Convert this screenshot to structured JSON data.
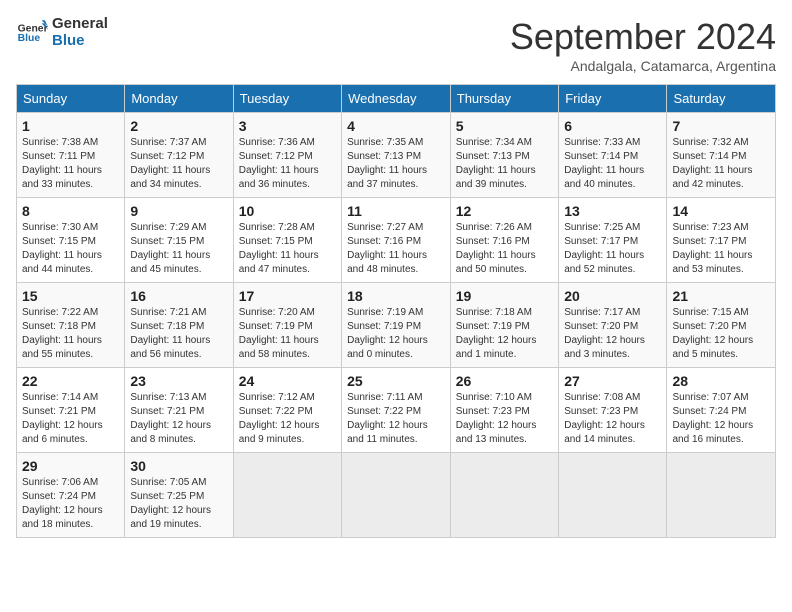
{
  "header": {
    "logo_line1": "General",
    "logo_line2": "Blue",
    "title": "September 2024",
    "subtitle": "Andalgala, Catamarca, Argentina"
  },
  "weekdays": [
    "Sunday",
    "Monday",
    "Tuesday",
    "Wednesday",
    "Thursday",
    "Friday",
    "Saturday"
  ],
  "weeks": [
    [
      {
        "day": "1",
        "detail": "Sunrise: 7:38 AM\nSunset: 7:11 PM\nDaylight: 11 hours\nand 33 minutes."
      },
      {
        "day": "2",
        "detail": "Sunrise: 7:37 AM\nSunset: 7:12 PM\nDaylight: 11 hours\nand 34 minutes."
      },
      {
        "day": "3",
        "detail": "Sunrise: 7:36 AM\nSunset: 7:12 PM\nDaylight: 11 hours\nand 36 minutes."
      },
      {
        "day": "4",
        "detail": "Sunrise: 7:35 AM\nSunset: 7:13 PM\nDaylight: 11 hours\nand 37 minutes."
      },
      {
        "day": "5",
        "detail": "Sunrise: 7:34 AM\nSunset: 7:13 PM\nDaylight: 11 hours\nand 39 minutes."
      },
      {
        "day": "6",
        "detail": "Sunrise: 7:33 AM\nSunset: 7:14 PM\nDaylight: 11 hours\nand 40 minutes."
      },
      {
        "day": "7",
        "detail": "Sunrise: 7:32 AM\nSunset: 7:14 PM\nDaylight: 11 hours\nand 42 minutes."
      }
    ],
    [
      {
        "day": "8",
        "detail": "Sunrise: 7:30 AM\nSunset: 7:15 PM\nDaylight: 11 hours\nand 44 minutes."
      },
      {
        "day": "9",
        "detail": "Sunrise: 7:29 AM\nSunset: 7:15 PM\nDaylight: 11 hours\nand 45 minutes."
      },
      {
        "day": "10",
        "detail": "Sunrise: 7:28 AM\nSunset: 7:15 PM\nDaylight: 11 hours\nand 47 minutes."
      },
      {
        "day": "11",
        "detail": "Sunrise: 7:27 AM\nSunset: 7:16 PM\nDaylight: 11 hours\nand 48 minutes."
      },
      {
        "day": "12",
        "detail": "Sunrise: 7:26 AM\nSunset: 7:16 PM\nDaylight: 11 hours\nand 50 minutes."
      },
      {
        "day": "13",
        "detail": "Sunrise: 7:25 AM\nSunset: 7:17 PM\nDaylight: 11 hours\nand 52 minutes."
      },
      {
        "day": "14",
        "detail": "Sunrise: 7:23 AM\nSunset: 7:17 PM\nDaylight: 11 hours\nand 53 minutes."
      }
    ],
    [
      {
        "day": "15",
        "detail": "Sunrise: 7:22 AM\nSunset: 7:18 PM\nDaylight: 11 hours\nand 55 minutes."
      },
      {
        "day": "16",
        "detail": "Sunrise: 7:21 AM\nSunset: 7:18 PM\nDaylight: 11 hours\nand 56 minutes."
      },
      {
        "day": "17",
        "detail": "Sunrise: 7:20 AM\nSunset: 7:19 PM\nDaylight: 11 hours\nand 58 minutes."
      },
      {
        "day": "18",
        "detail": "Sunrise: 7:19 AM\nSunset: 7:19 PM\nDaylight: 12 hours\nand 0 minutes."
      },
      {
        "day": "19",
        "detail": "Sunrise: 7:18 AM\nSunset: 7:19 PM\nDaylight: 12 hours\nand 1 minute."
      },
      {
        "day": "20",
        "detail": "Sunrise: 7:17 AM\nSunset: 7:20 PM\nDaylight: 12 hours\nand 3 minutes."
      },
      {
        "day": "21",
        "detail": "Sunrise: 7:15 AM\nSunset: 7:20 PM\nDaylight: 12 hours\nand 5 minutes."
      }
    ],
    [
      {
        "day": "22",
        "detail": "Sunrise: 7:14 AM\nSunset: 7:21 PM\nDaylight: 12 hours\nand 6 minutes."
      },
      {
        "day": "23",
        "detail": "Sunrise: 7:13 AM\nSunset: 7:21 PM\nDaylight: 12 hours\nand 8 minutes."
      },
      {
        "day": "24",
        "detail": "Sunrise: 7:12 AM\nSunset: 7:22 PM\nDaylight: 12 hours\nand 9 minutes."
      },
      {
        "day": "25",
        "detail": "Sunrise: 7:11 AM\nSunset: 7:22 PM\nDaylight: 12 hours\nand 11 minutes."
      },
      {
        "day": "26",
        "detail": "Sunrise: 7:10 AM\nSunset: 7:23 PM\nDaylight: 12 hours\nand 13 minutes."
      },
      {
        "day": "27",
        "detail": "Sunrise: 7:08 AM\nSunset: 7:23 PM\nDaylight: 12 hours\nand 14 minutes."
      },
      {
        "day": "28",
        "detail": "Sunrise: 7:07 AM\nSunset: 7:24 PM\nDaylight: 12 hours\nand 16 minutes."
      }
    ],
    [
      {
        "day": "29",
        "detail": "Sunrise: 7:06 AM\nSunset: 7:24 PM\nDaylight: 12 hours\nand 18 minutes."
      },
      {
        "day": "30",
        "detail": "Sunrise: 7:05 AM\nSunset: 7:25 PM\nDaylight: 12 hours\nand 19 minutes."
      },
      {
        "day": "",
        "detail": "",
        "empty": true
      },
      {
        "day": "",
        "detail": "",
        "empty": true
      },
      {
        "day": "",
        "detail": "",
        "empty": true
      },
      {
        "day": "",
        "detail": "",
        "empty": true
      },
      {
        "day": "",
        "detail": "",
        "empty": true
      }
    ]
  ]
}
